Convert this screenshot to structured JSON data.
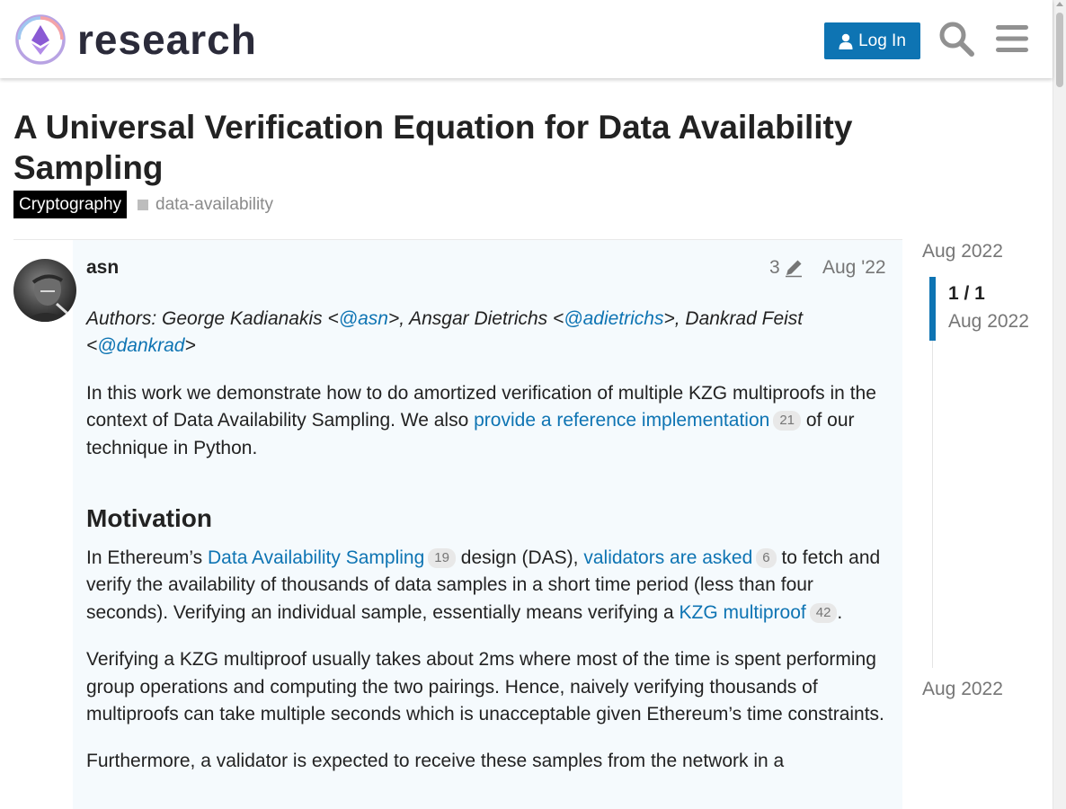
{
  "header": {
    "site_name": "research",
    "login_label": "Log In",
    "icons": [
      "logo-icon",
      "user-icon",
      "search-icon",
      "hamburger-menu-icon"
    ],
    "accent_color": "#0e74b3"
  },
  "topic": {
    "title": "A Universal Verification Equation for Data Availability Sampling",
    "category": "Cryptography",
    "tag": "data-availability"
  },
  "post": {
    "username": "asn",
    "edit_count": "3",
    "date": "Aug '22",
    "authors": {
      "prefix": "Authors: George Kadianakis <",
      "mention1": "@asn",
      "mid1": ">, Ansgar Dietrichs <",
      "mention2": "@adietrichs",
      "mid2": ">, Dankrad Feist <",
      "mention3": "@dankrad",
      "suffix": ">"
    },
    "intro": {
      "text_before": "In this work we demonstrate how to do amortized verification of multiple KZG multiproofs in the context of Data Availability Sampling. We also ",
      "link": "provide a reference implementation",
      "link_clicks": "21",
      "text_after": " of our technique in Python."
    },
    "heading": "Motivation",
    "para1": {
      "t1": "In Ethereum’s ",
      "link1": "Data Availability Sampling",
      "clicks1": "19",
      "t2": " design (DAS), ",
      "link2": "validators are asked",
      "clicks2": "6",
      "t3": " to fetch and verify the availability of thousands of data samples in a short time period (less than four seconds). Verifying an individual sample, essentially means verifying a ",
      "link3": "KZG multiproof",
      "clicks3": "42",
      "t4": "."
    },
    "para2": "Verifying a KZG multiproof usually takes about 2ms where most of the time is spent performing group operations and computing the two pairings. Hence, naively verifying thousands of multiproofs can take multiple seconds which is unacceptable given Ethereum’s time constraints.",
    "para3": "Furthermore, a validator is expected to receive these samples from the network in a"
  },
  "timeline": {
    "start_date": "Aug 2022",
    "position": "1 / 1",
    "current_date": "Aug 2022",
    "end_date": "Aug 2022"
  }
}
